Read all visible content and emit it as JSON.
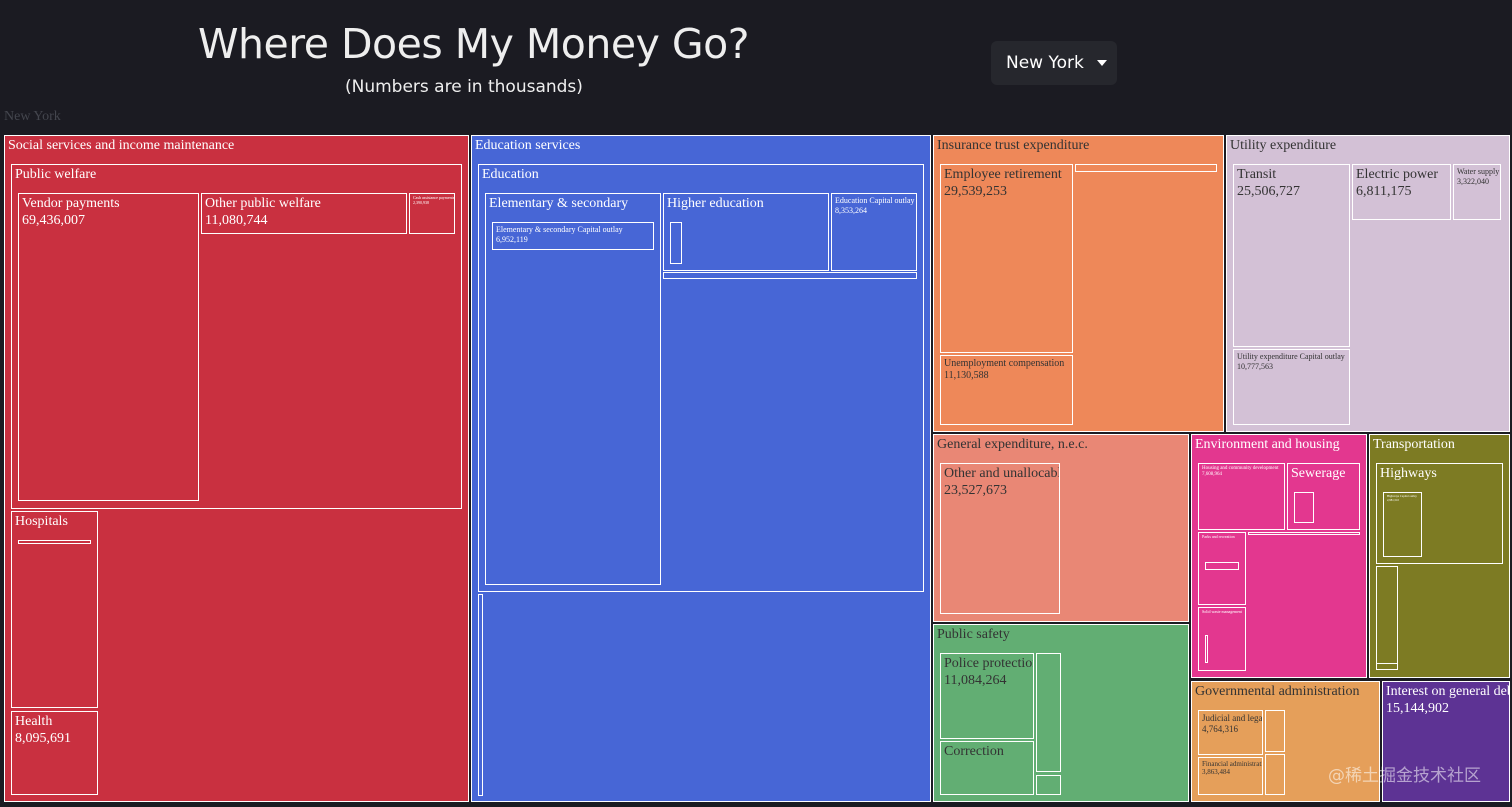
{
  "header": {
    "title": "Where Does My Money Go?",
    "subtitle": "(Numbers are in thousands)"
  },
  "state_select": {
    "selected": "New York",
    "icon": "caret-down-icon"
  },
  "chart_data": {
    "type": "treemap",
    "root": "New York",
    "groups": [
      {
        "name": "Social services and income maintenance",
        "color": "#c93040",
        "children": [
          {
            "name": "Public welfare",
            "children": [
              {
                "name": "Vendor payments",
                "value": 69436007
              },
              {
                "name": "Other public welfare",
                "value": 11080744
              },
              {
                "name": "Cash assistance payments",
                "value": 2390938
              }
            ]
          },
          {
            "name": "Hospitals"
          },
          {
            "name": "Health",
            "value": 8095691
          }
        ]
      },
      {
        "name": "Education services",
        "color": "#4766d6",
        "children": [
          {
            "name": "Education",
            "children": [
              {
                "name": "Elementary & secondary",
                "children": [
                  {
                    "name": "Elementary & secondary Capital outlay",
                    "value": 6952119
                  }
                ]
              },
              {
                "name": "Higher education"
              },
              {
                "name": "Education Capital outlay",
                "value": 8353264
              }
            ]
          }
        ]
      },
      {
        "name": "Insurance trust expenditure",
        "color": "#ee8859",
        "children": [
          {
            "name": "Employee retirement",
            "value": 29539253
          },
          {
            "name": "Unemployment compensation",
            "value": 11130588
          }
        ]
      },
      {
        "name": "Utility expenditure",
        "color": "#d3c1d6",
        "children": [
          {
            "name": "Transit",
            "value": 25506727
          },
          {
            "name": "Electric power",
            "value": 6811175
          },
          {
            "name": "Water supply",
            "value": 3322040
          },
          {
            "name": "Utility expenditure Capital outlay",
            "value": 10777563
          }
        ]
      },
      {
        "name": "General expenditure, n.e.c.",
        "color": "#e98775",
        "children": [
          {
            "name": "Other and unallocable",
            "value": 23527673
          }
        ]
      },
      {
        "name": "Environment and housing",
        "color": "#e3378f",
        "children": [
          {
            "name": "Housing and community development",
            "value": 7608964
          },
          {
            "name": "Sewerage"
          },
          {
            "name": "Parks and recreation"
          },
          {
            "name": "Solid waste management"
          }
        ]
      },
      {
        "name": "Transportation",
        "color": "#7d7b23",
        "children": [
          {
            "name": "Highways",
            "children": [
              {
                "name": "Highways Capital outlay",
                "value": 2981510
              }
            ]
          }
        ]
      },
      {
        "name": "Public safety",
        "color": "#62ae73",
        "children": [
          {
            "name": "Police protection",
            "value": 11084264
          },
          {
            "name": "Correction"
          }
        ]
      },
      {
        "name": "Governmental administration",
        "color": "#e59f5a",
        "children": [
          {
            "name": "Judicial and legal",
            "value": 4764316
          },
          {
            "name": "Financial administration",
            "value": 3863484
          }
        ]
      },
      {
        "name": "Interest on general debt",
        "color": "#5d3394",
        "value": 15144902
      }
    ]
  },
  "watermark": "@稀土掘金技术社区"
}
